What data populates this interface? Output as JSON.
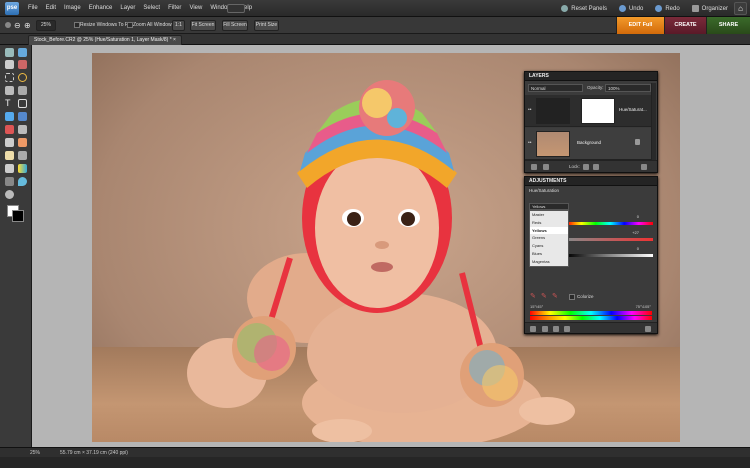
{
  "app": {
    "logo": "pse"
  },
  "menu": [
    "File",
    "Edit",
    "Image",
    "Enhance",
    "Layer",
    "Select",
    "Filter",
    "View",
    "Window",
    "Help"
  ],
  "topright": {
    "reset": "Reset Panels",
    "undo": "Undo",
    "redo": "Redo",
    "organizer": "Organizer"
  },
  "options": {
    "zoom": "25%",
    "resize": "Resize Windows To Fit",
    "zoomall": "Zoom All Windows",
    "one": "1:1",
    "fit": "Fit Screen",
    "fill": "Fill Screen",
    "print": "Print Size"
  },
  "modes": {
    "edit": "EDIT Full",
    "create": "CREATE",
    "share": "SHARE"
  },
  "doc": {
    "tab": "Stock_Before.CR2 @ 25% (Hue/Saturation 1, Layer Mask/8) *",
    "close": "×"
  },
  "status": {
    "zoom": "25%",
    "info": "55.79 cm × 37.19 cm (240 ppi)"
  },
  "layers": {
    "title": "LAYERS",
    "blend": "Normal",
    "opacity_label": "Opacity:",
    "opacity": "100%",
    "items": [
      {
        "name": "Hue/Saturat..."
      },
      {
        "name": "Background"
      }
    ],
    "lock": "Lock:"
  },
  "adjustments": {
    "title": "ADJUSTMENTS",
    "subtitle": "Hue/Saturation",
    "selected": "Yellows",
    "options": [
      "Master",
      "Reds",
      "Yellows",
      "Greens",
      "Cyans",
      "Blues",
      "Magentas"
    ],
    "values": [
      "0",
      "+27",
      "0"
    ],
    "colorize": "Colorize",
    "range_left": "15°/45°",
    "range_right": "75°\\105°"
  }
}
